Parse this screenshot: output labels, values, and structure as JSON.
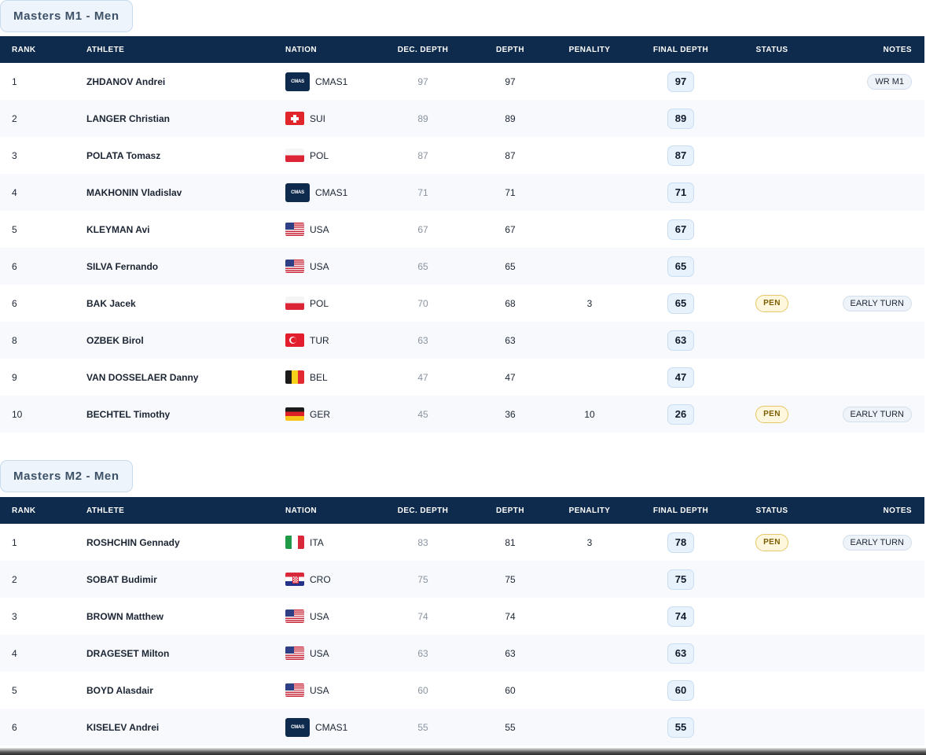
{
  "headers": {
    "rank": "RANK",
    "athlete": "ATHLETE",
    "nation": "NATION",
    "dec_depth": "DEC. DEPTH",
    "depth": "DEPTH",
    "penalty": "PENALITY",
    "final_depth": "FINAL DEPTH",
    "status": "STATUS",
    "notes": "NOTES"
  },
  "sections": [
    {
      "title": "Masters M1 - Men",
      "rows": [
        {
          "rank": "1",
          "athlete": "ZHDANOV Andrei",
          "flag": "cmas-logo",
          "nation": "CMAS1",
          "dec": "97",
          "depth": "97",
          "penalty": "",
          "final": "97",
          "status": "",
          "notes": "WR M1"
        },
        {
          "rank": "2",
          "athlete": "LANGER Christian",
          "flag": "switzerland-flag",
          "nation": "SUI",
          "dec": "89",
          "depth": "89",
          "penalty": "",
          "final": "89",
          "status": "",
          "notes": ""
        },
        {
          "rank": "3",
          "athlete": "POLATA Tomasz",
          "flag": "poland-flag",
          "nation": "POL",
          "dec": "87",
          "depth": "87",
          "penalty": "",
          "final": "87",
          "status": "",
          "notes": ""
        },
        {
          "rank": "4",
          "athlete": "MAKHONIN Vladislav",
          "flag": "cmas-logo",
          "nation": "CMAS1",
          "dec": "71",
          "depth": "71",
          "penalty": "",
          "final": "71",
          "status": "",
          "notes": ""
        },
        {
          "rank": "5",
          "athlete": "KLEYMAN Avi",
          "flag": "usa-flag",
          "nation": "USA",
          "dec": "67",
          "depth": "67",
          "penalty": "",
          "final": "67",
          "status": "",
          "notes": ""
        },
        {
          "rank": "6",
          "athlete": "SILVA Fernando",
          "flag": "usa-flag",
          "nation": "USA",
          "dec": "65",
          "depth": "65",
          "penalty": "",
          "final": "65",
          "status": "",
          "notes": ""
        },
        {
          "rank": "6",
          "athlete": "BAK Jacek",
          "flag": "poland-flag",
          "nation": "POL",
          "dec": "70",
          "depth": "68",
          "penalty": "3",
          "final": "65",
          "status": "PEN",
          "notes": "EARLY TURN"
        },
        {
          "rank": "8",
          "athlete": "OZBEK Birol",
          "flag": "turkey-flag",
          "nation": "TUR",
          "dec": "63",
          "depth": "63",
          "penalty": "",
          "final": "63",
          "status": "",
          "notes": ""
        },
        {
          "rank": "9",
          "athlete": "VAN DOSSELAER Danny",
          "flag": "belgium-flag",
          "nation": "BEL",
          "dec": "47",
          "depth": "47",
          "penalty": "",
          "final": "47",
          "status": "",
          "notes": ""
        },
        {
          "rank": "10",
          "athlete": "BECHTEL Timothy",
          "flag": "germany-flag",
          "nation": "GER",
          "dec": "45",
          "depth": "36",
          "penalty": "10",
          "final": "26",
          "status": "PEN",
          "notes": "EARLY TURN"
        }
      ]
    },
    {
      "title": "Masters M2 - Men",
      "rows": [
        {
          "rank": "1",
          "athlete": "ROSHCHIN Gennady",
          "flag": "italy-flag",
          "nation": "ITA",
          "dec": "83",
          "depth": "81",
          "penalty": "3",
          "final": "78",
          "status": "PEN",
          "notes": "EARLY TURN"
        },
        {
          "rank": "2",
          "athlete": "SOBAT Budimir",
          "flag": "croatia-flag",
          "nation": "CRO",
          "dec": "75",
          "depth": "75",
          "penalty": "",
          "final": "75",
          "status": "",
          "notes": ""
        },
        {
          "rank": "3",
          "athlete": "BROWN Matthew",
          "flag": "usa-flag",
          "nation": "USA",
          "dec": "74",
          "depth": "74",
          "penalty": "",
          "final": "74",
          "status": "",
          "notes": ""
        },
        {
          "rank": "4",
          "athlete": "DRAGESET Milton",
          "flag": "usa-flag",
          "nation": "USA",
          "dec": "63",
          "depth": "63",
          "penalty": "",
          "final": "63",
          "status": "",
          "notes": ""
        },
        {
          "rank": "5",
          "athlete": "BOYD Alasdair",
          "flag": "usa-flag",
          "nation": "USA",
          "dec": "60",
          "depth": "60",
          "penalty": "",
          "final": "60",
          "status": "",
          "notes": ""
        },
        {
          "rank": "6",
          "athlete": "KISELEV Andrei",
          "flag": "cmas-logo",
          "nation": "CMAS1",
          "dec": "55",
          "depth": "55",
          "penalty": "",
          "final": "55",
          "status": "",
          "notes": ""
        }
      ]
    }
  ]
}
